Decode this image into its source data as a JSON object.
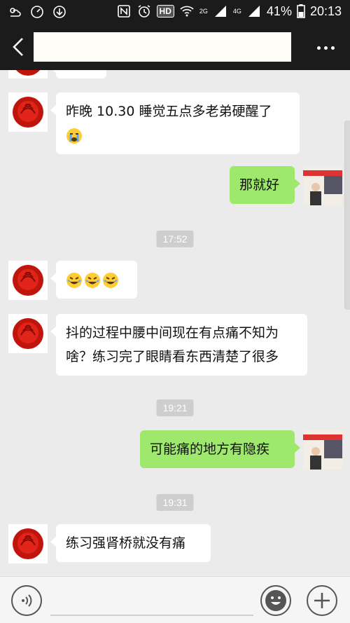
{
  "status_bar": {
    "battery_percent": "41%",
    "time": "20:13",
    "hd_label": "HD",
    "net_2g": "2G",
    "net_4g": "4G"
  },
  "header": {
    "title": ""
  },
  "messages": [
    {
      "side": "in",
      "text": "昨晚 10.30 睡觉五点多老弟硬醒了",
      "emoji": [
        "loudly-crying-face"
      ]
    },
    {
      "side": "out",
      "text": "那就好"
    },
    {
      "time": "17:52"
    },
    {
      "side": "in",
      "text": "",
      "emoji": [
        "rolling-laughing-face",
        "rolling-laughing-face",
        "rolling-laughing-face"
      ]
    },
    {
      "side": "in",
      "line1": "抖的过程中腰中间现在有点痛不知为",
      "line2": "啥？练习完了眼睛看东西清楚了很多"
    },
    {
      "time": "19:21"
    },
    {
      "side": "out",
      "text": "可能痛的地方有隐疾"
    },
    {
      "time": "19:31"
    },
    {
      "side": "in",
      "text": "练习强肾桥就没有痛"
    }
  ],
  "icons": {
    "back": "back-arrow-icon",
    "more": "more-icon",
    "voice": "voice-icon",
    "emoji": "smiley-icon",
    "plus": "plus-icon"
  },
  "colors": {
    "bar": "#1b1b1b",
    "chat_bg": "#ebebeb",
    "bubble_in": "#ffffff",
    "bubble_out": "#9ee86d",
    "timestamp_bg": "#cecece"
  }
}
